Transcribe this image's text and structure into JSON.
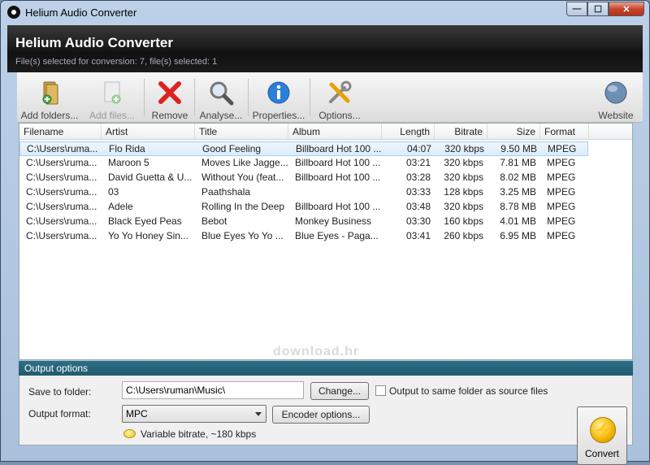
{
  "window": {
    "title": "Helium Audio Converter",
    "close_glyph": "✕",
    "min_glyph": "—",
    "max_glyph": "☐"
  },
  "header": {
    "app_title": "Helium Audio Converter",
    "selection_info": "File(s) selected for conversion: 7, file(s) selected: 1"
  },
  "toolbar": {
    "add_folders": "Add folders...",
    "add_files": "Add files...",
    "remove": "Remove",
    "analyse": "Analyse...",
    "properties": "Properties...",
    "options": "Options...",
    "website": "Website"
  },
  "table": {
    "columns": [
      "Filename",
      "Artist",
      "Title",
      "Album",
      "Length",
      "Bitrate",
      "Size",
      "Format"
    ],
    "rows": [
      [
        "C:\\Users\\ruma...",
        "Flo Rida",
        "Good Feeling",
        "Billboard Hot 100 ...",
        "04:07",
        "320 kbps",
        "9.50 MB",
        "MPEG"
      ],
      [
        "C:\\Users\\ruma...",
        "Maroon 5",
        "Moves Like Jagge...",
        "Billboard Hot 100 ...",
        "03:21",
        "320 kbps",
        "7.81 MB",
        "MPEG"
      ],
      [
        "C:\\Users\\ruma...",
        "David Guetta & U...",
        "Without You (feat...",
        "Billboard Hot 100 ...",
        "03:28",
        "320 kbps",
        "8.02 MB",
        "MPEG"
      ],
      [
        "C:\\Users\\ruma...",
        "03",
        "Paathshala",
        "",
        "03:33",
        "128 kbps",
        "3.25 MB",
        "MPEG"
      ],
      [
        "C:\\Users\\ruma...",
        "Adele",
        "Rolling In the Deep",
        "Billboard Hot 100 ...",
        "03:48",
        "320 kbps",
        "8.78 MB",
        "MPEG"
      ],
      [
        "C:\\Users\\ruma...",
        "Black Eyed Peas",
        "Bebot",
        "Monkey Business",
        "03:30",
        "160 kbps",
        "4.01 MB",
        "MPEG"
      ],
      [
        "C:\\Users\\ruma...",
        "Yo Yo Honey Sin...",
        "Blue Eyes Yo Yo ...",
        "Blue Eyes - Paga...",
        "03:41",
        "260 kbps",
        "6.95 MB",
        "MPEG"
      ]
    ],
    "selected_row": 0
  },
  "watermark": "download.hr",
  "output": {
    "header": "Output options",
    "save_label": "Save to folder:",
    "save_value": "C:\\Users\\ruman\\Music\\",
    "change_button": "Change...",
    "same_folder_label": "Output to same folder as source files",
    "same_folder_checked": false,
    "format_label": "Output format:",
    "format_value": "MPC",
    "encoder_button": "Encoder options...",
    "info_text": "Variable bitrate, ~180 kbps",
    "convert_button": "Convert",
    "convert_glyph": "⚡"
  },
  "colors": {
    "header_bg": "#1b1b1b",
    "output_header_bg": "#205a6e",
    "selection": "#dcebfb"
  }
}
